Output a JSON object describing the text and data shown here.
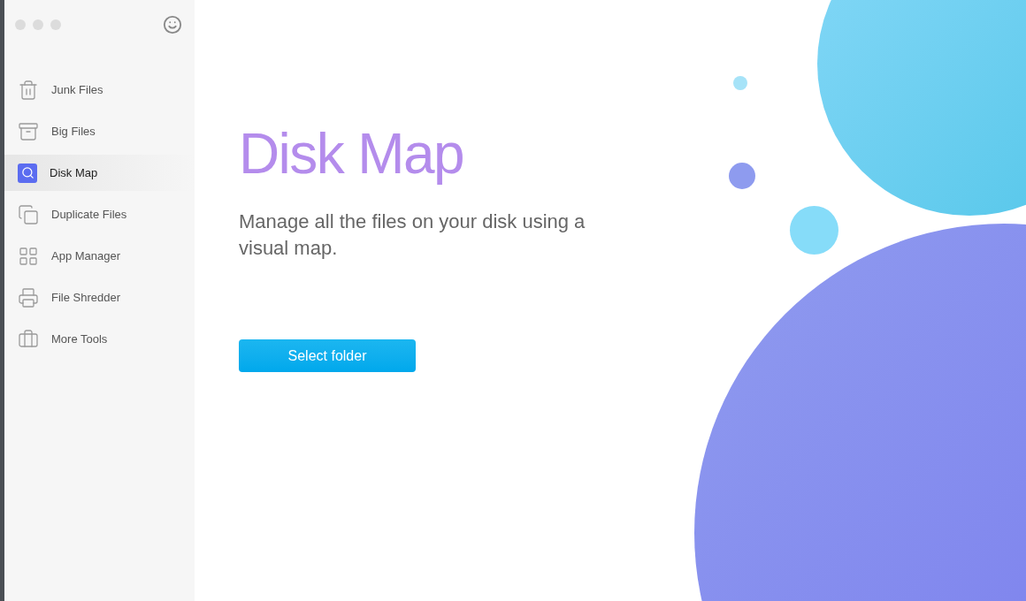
{
  "sidebar": {
    "items": [
      {
        "label": "Junk Files",
        "selected": false
      },
      {
        "label": "Big Files",
        "selected": false
      },
      {
        "label": "Disk Map",
        "selected": true
      },
      {
        "label": "Duplicate Files",
        "selected": false
      },
      {
        "label": "App Manager",
        "selected": false
      },
      {
        "label": "File Shredder",
        "selected": false
      },
      {
        "label": "More Tools",
        "selected": false
      }
    ]
  },
  "main": {
    "title": "Disk Map",
    "description": "Manage all the files on your disk using a visual map.",
    "button": "Select folder"
  }
}
